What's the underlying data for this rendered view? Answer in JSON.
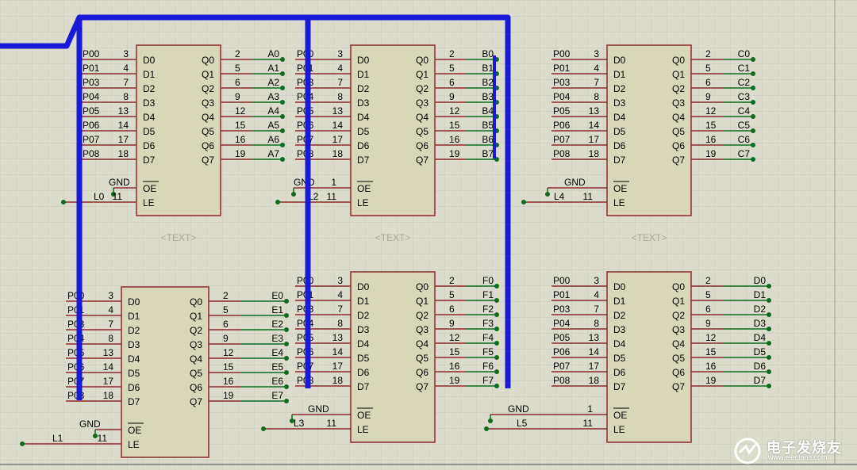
{
  "colors": {
    "background": "#dcdccc",
    "grid": "#c8c8ba",
    "chip_fill": "#d8d8b8",
    "chip_border": "#8b2a2a",
    "wire": "#0f6b1e",
    "bus": "#1a1ad6",
    "pin": "#8b2a2a",
    "placeholder": "#a8a89a"
  },
  "chip_pins": {
    "inputs": [
      "D0",
      "D1",
      "D2",
      "D3",
      "D4",
      "D5",
      "D6",
      "D7"
    ],
    "outputs": [
      "Q0",
      "Q1",
      "Q2",
      "Q3",
      "Q4",
      "Q5",
      "Q6",
      "Q7"
    ],
    "oe": "OE",
    "le": "LE",
    "in_nums": [
      "3",
      "4",
      "7",
      "8",
      "13",
      "14",
      "17",
      "18"
    ],
    "out_nums": [
      "2",
      "5",
      "6",
      "9",
      "12",
      "15",
      "16",
      "19"
    ],
    "oe_num": "1",
    "le_num": "11"
  },
  "text_placeholder": "<TEXT>",
  "gnd_label": "GND",
  "chips": [
    {
      "id": "latch-l0",
      "in_nets": [
        "P00",
        "P01",
        "P03",
        "P04",
        "P05",
        "P06",
        "P07",
        "P08"
      ],
      "out_nets": [
        "A0",
        "A1",
        "A2",
        "A3",
        "A4",
        "A5",
        "A6",
        "A7"
      ],
      "le_net": "L0",
      "show_oe_num": false,
      "show_text": true
    },
    {
      "id": "latch-l2",
      "in_nets": [
        "P00",
        "P01",
        "P03",
        "P04",
        "P05",
        "P06",
        "P07",
        "P08"
      ],
      "out_nets": [
        "B0",
        "B1",
        "B2",
        "B3",
        "B4",
        "B5",
        "B6",
        "B7"
      ],
      "le_net": "L2",
      "show_oe_num": true,
      "show_text": true
    },
    {
      "id": "latch-l4",
      "in_nets": [
        "P00",
        "P01",
        "P03",
        "P04",
        "P05",
        "P06",
        "P07",
        "P08"
      ],
      "out_nets": [
        "C0",
        "C1",
        "C2",
        "C3",
        "C4",
        "C5",
        "C6",
        "C7"
      ],
      "le_net": "L4",
      "show_oe_num": false,
      "show_text": true
    },
    {
      "id": "latch-l1",
      "in_nets": [
        "P00",
        "P01",
        "P03",
        "P04",
        "P05",
        "P06",
        "P07",
        "P08"
      ],
      "out_nets": [
        "E0",
        "E1",
        "E2",
        "E3",
        "E4",
        "E5",
        "E6",
        "E7"
      ],
      "le_net": "L1",
      "show_oe_num": false,
      "show_text": false
    },
    {
      "id": "latch-l3",
      "in_nets": [
        "P00",
        "P01",
        "P03",
        "P04",
        "P05",
        "P06",
        "P07",
        "P08"
      ],
      "out_nets": [
        "F0",
        "F1",
        "F2",
        "F3",
        "F4",
        "F5",
        "F6",
        "F7"
      ],
      "le_net": "L3",
      "show_oe_num": false,
      "show_text": false
    },
    {
      "id": "latch-l5",
      "in_nets": [
        "P00",
        "P01",
        "P03",
        "P04",
        "P05",
        "P06",
        "P07",
        "P08"
      ],
      "out_nets": [
        "D0",
        "D1",
        "D2",
        "D3",
        "D4",
        "D5",
        "D6",
        "D7"
      ],
      "le_net": "L5",
      "show_oe_num": true,
      "show_text": false
    }
  ],
  "watermark": {
    "text": "电子发烧友",
    "url": "www.elecfans.com"
  }
}
